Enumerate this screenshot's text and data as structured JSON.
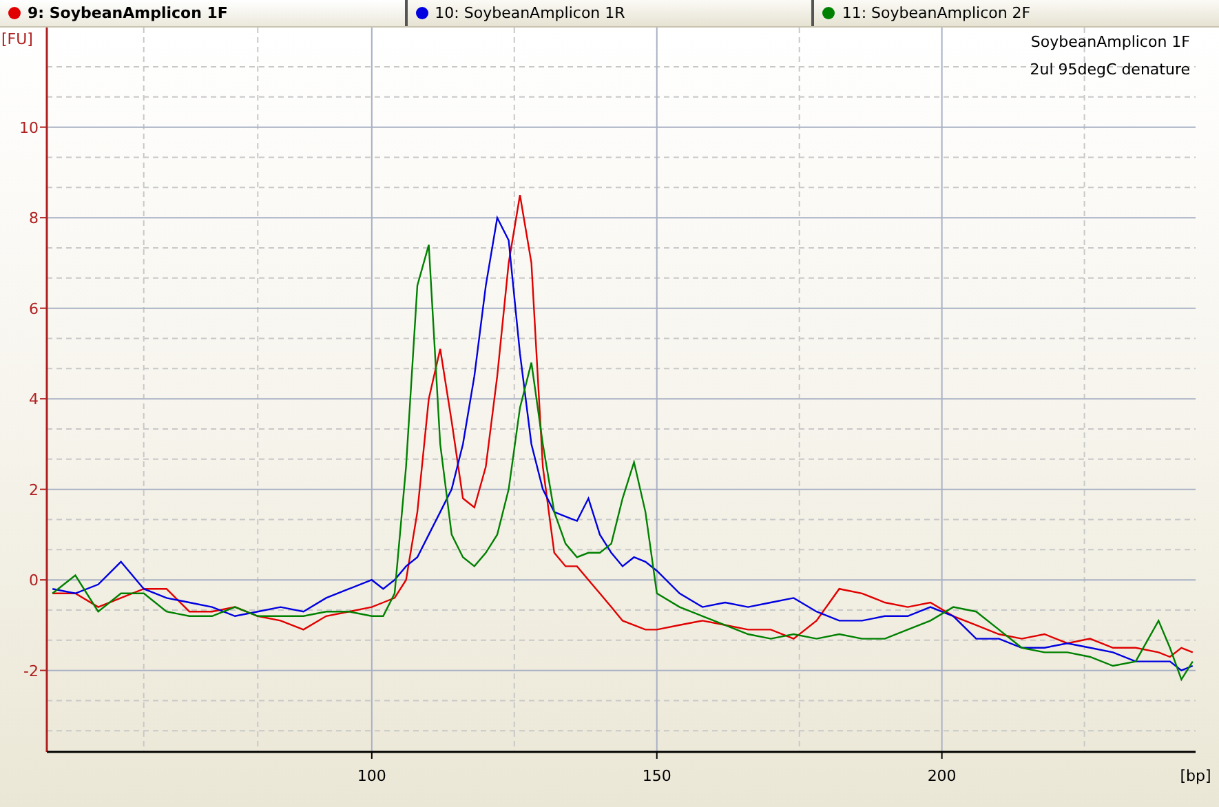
{
  "tabs": [
    {
      "selected": true
    },
    {
      "selected": false
    },
    {
      "selected": false
    }
  ],
  "sample_info": [
    "SoybeanAmplicon 1F",
    "2ul 95degC denature"
  ],
  "chart_data": {
    "type": "line",
    "grid": true,
    "xlabel": "[bp]",
    "ylabel": "[FU]",
    "xlim": [
      43,
      244.5
    ],
    "ylim": [
      -3.8,
      12.2
    ],
    "xticks": [
      100,
      150,
      200
    ],
    "yticks": [
      -2,
      0,
      2,
      4,
      6,
      8,
      10
    ],
    "x": [
      44,
      48,
      52,
      56,
      60,
      64,
      68,
      72,
      76,
      80,
      84,
      88,
      92,
      96,
      100,
      102,
      104,
      106,
      108,
      110,
      112,
      114,
      116,
      118,
      120,
      122,
      124,
      126,
      128,
      130,
      132,
      134,
      136,
      138,
      140,
      142,
      144,
      146,
      148,
      150,
      154,
      158,
      162,
      166,
      170,
      174,
      178,
      182,
      186,
      190,
      194,
      198,
      202,
      206,
      210,
      214,
      218,
      222,
      226,
      230,
      234,
      238,
      240,
      242,
      244
    ],
    "series": [
      {
        "name": "9: SoybeanAmplicon 1F",
        "color": "#e00000",
        "values": [
          -0.3,
          -0.3,
          -0.6,
          -0.4,
          -0.2,
          -0.2,
          -0.7,
          -0.7,
          -0.6,
          -0.8,
          -0.9,
          -1.1,
          -0.8,
          -0.7,
          -0.6,
          -0.5,
          -0.4,
          0.0,
          1.5,
          4.0,
          5.1,
          3.5,
          1.8,
          1.6,
          2.5,
          4.5,
          7.0,
          8.5,
          7.0,
          2.5,
          0.6,
          0.3,
          0.3,
          0.0,
          -0.3,
          -0.6,
          -0.9,
          -1.0,
          -1.1,
          -1.1,
          -1.0,
          -0.9,
          -1.0,
          -1.1,
          -1.1,
          -1.3,
          -0.9,
          -0.2,
          -0.3,
          -0.5,
          -0.6,
          -0.5,
          -0.8,
          -1.0,
          -1.2,
          -1.3,
          -1.2,
          -1.4,
          -1.3,
          -1.5,
          -1.5,
          -1.6,
          -1.7,
          -1.5,
          -1.6
        ]
      },
      {
        "name": "10: SoybeanAmplicon 1R",
        "color": "#0000e0",
        "values": [
          -0.2,
          -0.3,
          -0.1,
          0.4,
          -0.2,
          -0.4,
          -0.5,
          -0.6,
          -0.8,
          -0.7,
          -0.6,
          -0.7,
          -0.4,
          -0.2,
          0.0,
          -0.2,
          0.0,
          0.3,
          0.5,
          1.0,
          1.5,
          2.0,
          3.0,
          4.5,
          6.5,
          8.0,
          7.5,
          5.0,
          3.0,
          2.0,
          1.5,
          1.4,
          1.3,
          1.8,
          1.0,
          0.6,
          0.3,
          0.5,
          0.4,
          0.2,
          -0.3,
          -0.6,
          -0.5,
          -0.6,
          -0.5,
          -0.4,
          -0.7,
          -0.9,
          -0.9,
          -0.8,
          -0.8,
          -0.6,
          -0.8,
          -1.3,
          -1.3,
          -1.5,
          -1.5,
          -1.4,
          -1.5,
          -1.6,
          -1.8,
          -1.8,
          -1.8,
          -2.0,
          -1.9
        ]
      },
      {
        "name": "11: SoybeanAmplicon 2F",
        "color": "#008000",
        "values": [
          -0.3,
          0.1,
          -0.7,
          -0.3,
          -0.3,
          -0.7,
          -0.8,
          -0.8,
          -0.6,
          -0.8,
          -0.8,
          -0.8,
          -0.7,
          -0.7,
          -0.8,
          -0.8,
          -0.3,
          2.5,
          6.5,
          7.4,
          3.0,
          1.0,
          0.5,
          0.3,
          0.6,
          1.0,
          2.0,
          3.8,
          4.8,
          3.0,
          1.5,
          0.8,
          0.5,
          0.6,
          0.6,
          0.8,
          1.8,
          2.6,
          1.5,
          -0.3,
          -0.6,
          -0.8,
          -1.0,
          -1.2,
          -1.3,
          -1.2,
          -1.3,
          -1.2,
          -1.3,
          -1.3,
          -1.1,
          -0.9,
          -0.6,
          -0.7,
          -1.1,
          -1.5,
          -1.6,
          -1.6,
          -1.7,
          -1.9,
          -1.8,
          -0.9,
          -1.5,
          -2.2,
          -1.8
        ]
      }
    ]
  }
}
